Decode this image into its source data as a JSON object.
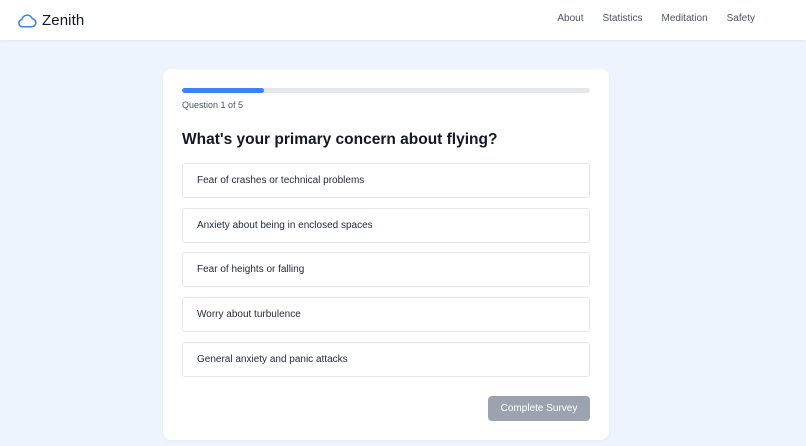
{
  "brand": {
    "name": "Zenith",
    "logo_icon": "cloud-icon",
    "accent_color": "#3b82f6"
  },
  "nav": {
    "items": [
      {
        "label": "About"
      },
      {
        "label": "Statistics"
      },
      {
        "label": "Meditation"
      },
      {
        "label": "Safety"
      }
    ]
  },
  "survey": {
    "progress_fraction": 0.2,
    "progress_text": "Question 1 of 5",
    "question": "What's your primary concern about flying?",
    "options": [
      {
        "label": "Fear of crashes or technical problems"
      },
      {
        "label": "Anxiety about being in enclosed spaces"
      },
      {
        "label": "Fear of heights or falling"
      },
      {
        "label": "Worry about turbulence"
      },
      {
        "label": "General anxiety and panic attacks"
      }
    ],
    "submit_label": "Complete Survey",
    "submit_disabled": true
  }
}
